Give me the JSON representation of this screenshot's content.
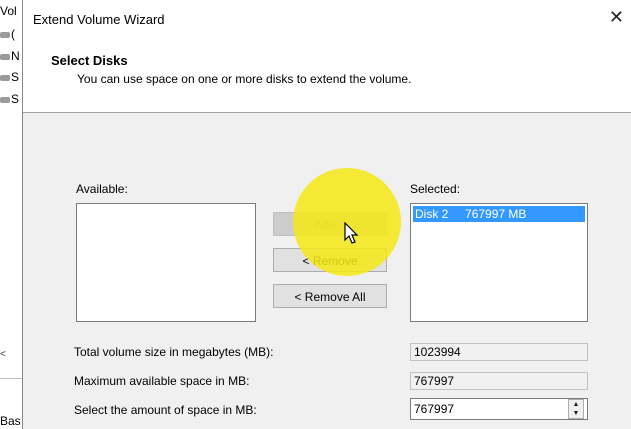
{
  "background_window": {
    "title_fragment": "Vol",
    "items": [
      {
        "text": "("
      },
      {
        "text": "N"
      },
      {
        "text": "S"
      },
      {
        "text": "S"
      }
    ],
    "scroll_glyph": "<",
    "bottom_text": "Bas"
  },
  "dialog": {
    "title": "Extend Volume Wizard",
    "close_glyph": "✕",
    "header": {
      "title": "Select Disks",
      "subtitle": "You can use space on one or more disks to extend the volume."
    },
    "available_label": "Available:",
    "selected_label": "Selected:",
    "selected_items": [
      {
        "disk": "Disk 2",
        "size": "767997 MB"
      }
    ],
    "buttons": {
      "add": "Add >",
      "remove": "< Remove",
      "remove_all": "< Remove All"
    },
    "fields": {
      "total_label": "Total volume size in megabytes (MB):",
      "total_value": "1023994",
      "max_label": "Maximum available space in MB:",
      "max_value": "767997",
      "amount_label": "Select the amount of space in MB:",
      "amount_value": "767997"
    },
    "highlight_color": "#f5e814",
    "selection_color": "#3399ff"
  }
}
